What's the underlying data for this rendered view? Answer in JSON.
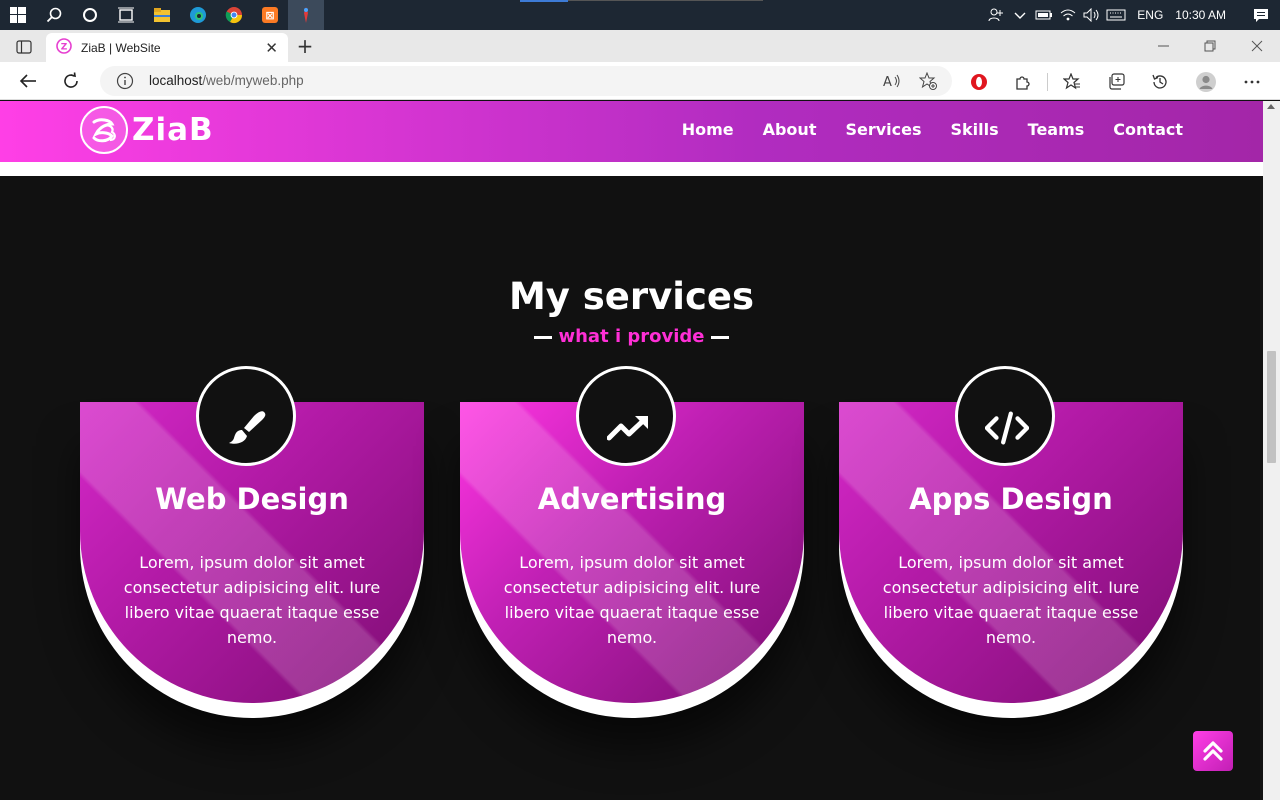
{
  "taskbar": {
    "language": "ENG",
    "time": "10:30 AM",
    "icons": [
      "windows-start-icon",
      "search-icon",
      "cortana-icon",
      "task-view-icon",
      "file-explorer-icon",
      "edge-icon",
      "chrome-icon",
      "xampp-icon",
      "app-icon"
    ]
  },
  "browser": {
    "tab_title": "ZiaB | WebSite",
    "url_host": "localhost",
    "url_path": "/web/myweb.php"
  },
  "site": {
    "logo_text": "ZiaB",
    "menu": [
      "Home",
      "About",
      "Services",
      "Skills",
      "Teams",
      "Contact"
    ],
    "brand_color": "#ff3fe6"
  },
  "services": {
    "title": "My services",
    "subtitle": "what i provide",
    "cards": [
      {
        "title": "Web Design",
        "icon": "paintbrush-icon",
        "text": "Lorem, ipsum dolor sit amet consectetur adipisicing elit. Iure libero vitae quaerat itaque esse nemo."
      },
      {
        "title": "Advertising",
        "icon": "trending-up-icon",
        "text": "Lorem, ipsum dolor sit amet consectetur adipisicing elit. Iure libero vitae quaerat itaque esse nemo."
      },
      {
        "title": "Apps Design",
        "icon": "code-icon",
        "text": "Lorem, ipsum dolor sit amet consectetur adipisicing elit. Iure libero vitae quaerat itaque esse nemo."
      }
    ]
  }
}
